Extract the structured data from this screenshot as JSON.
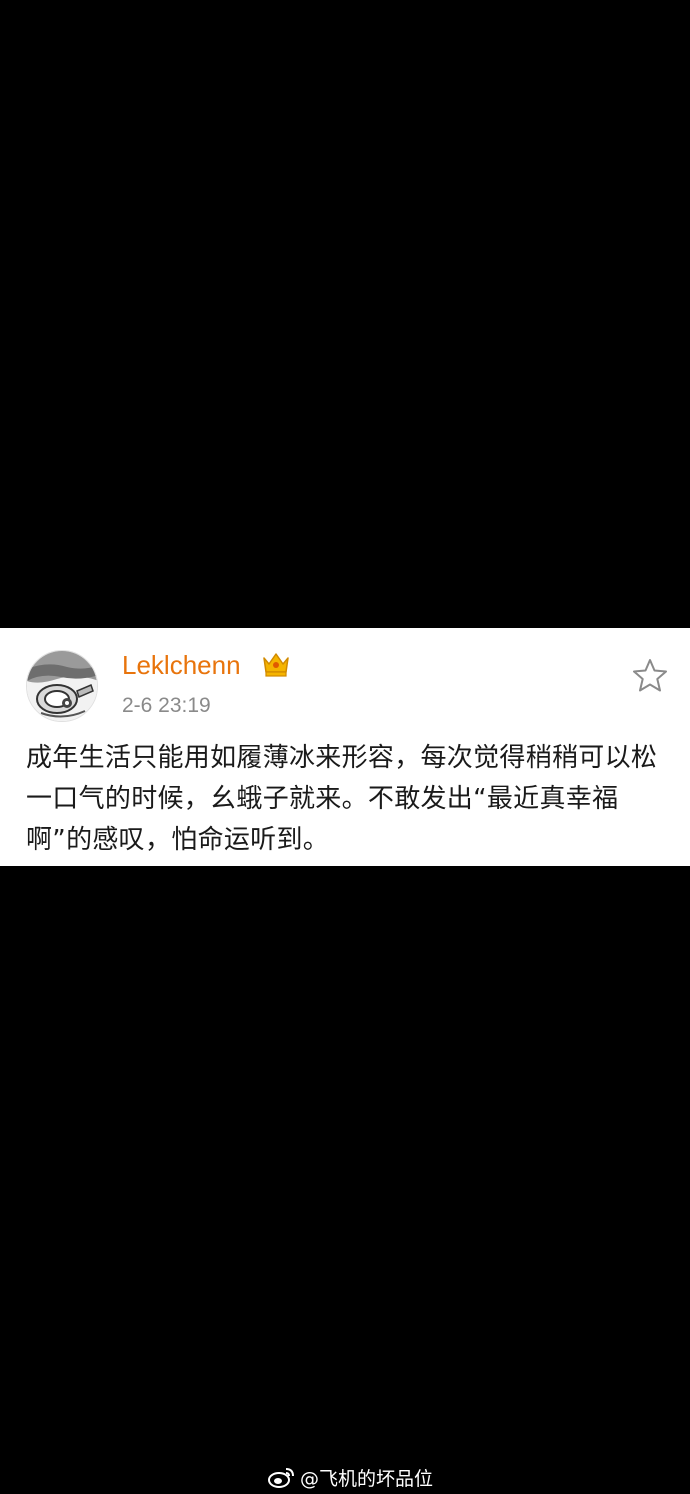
{
  "post": {
    "username": "Leklchenn",
    "timestamp": "2-6 23:19",
    "text": "成年生活只能用如履薄冰来形容，每次觉得稍稍可以松一口气的时候，幺蛾子就来。不敢发出“最近真幸福啊”的感叹，怕命运听到。",
    "badge_icon": "crown-icon",
    "favorite_icon": "star-outline-icon"
  },
  "watermark": {
    "text": "@飞机的坏品位",
    "icon": "weibo-logo-icon"
  },
  "colors": {
    "background": "#000000",
    "card": "#ffffff",
    "username": "#e8740c",
    "timestamp": "#8a8a8a",
    "text": "#1a1a1a"
  }
}
